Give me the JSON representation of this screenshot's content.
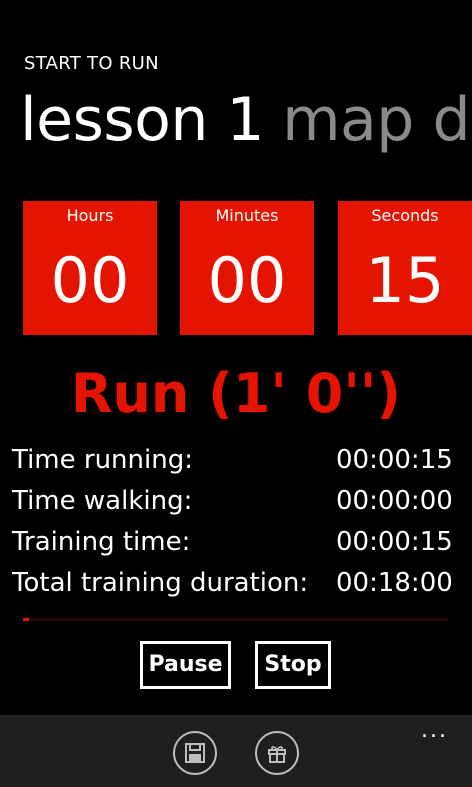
{
  "header": {
    "app_title": "START TO RUN",
    "pivot_active": "lesson 1",
    "pivot_next": "map d"
  },
  "timer": {
    "hours_label": "Hours",
    "hours_value": "00",
    "minutes_label": "Minutes",
    "minutes_value": "00",
    "seconds_label": "Seconds",
    "seconds_value": "15"
  },
  "phase": {
    "text": "Run (1' 0'')"
  },
  "stats": [
    {
      "label": "Time running:",
      "value": "00:00:15"
    },
    {
      "label": "Time walking:",
      "value": "00:00:00"
    },
    {
      "label": "Training time:",
      "value": "00:00:15"
    },
    {
      "label": "Total training duration:",
      "value": "00:18:00"
    }
  ],
  "progress": {
    "fraction": 0.014
  },
  "controls": {
    "pause_label": "Pause",
    "stop_label": "Stop"
  },
  "appbar": {
    "buttons": [
      {
        "icon": "save-icon"
      },
      {
        "icon": "gift-icon"
      }
    ],
    "more": "..."
  },
  "colors": {
    "accent": "#e51400",
    "background": "#000000",
    "appbar": "#1f1f1f",
    "pivot_inactive": "#8a8a8a"
  }
}
